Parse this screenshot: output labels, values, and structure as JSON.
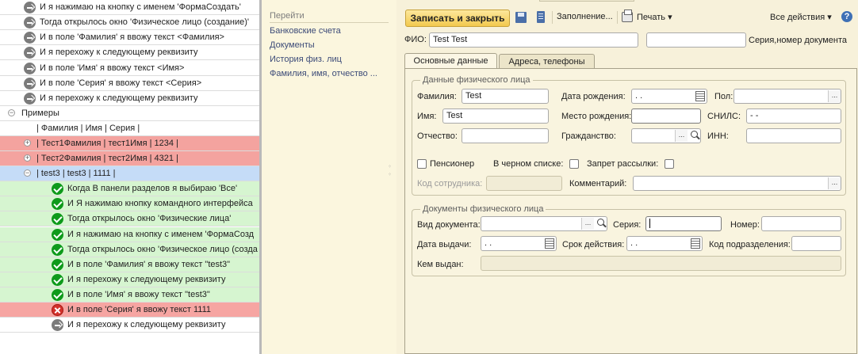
{
  "tree": {
    "rows": [
      {
        "text": "И я нажимаю на кнопку с именем 'ФормаСоздать'",
        "icon": "gray",
        "bg": "white"
      },
      {
        "text": "Тогда открылось окно 'Физическое лицо (создание)'",
        "icon": "gray",
        "bg": "white"
      },
      {
        "text": "И в поле 'Фамилия' я ввожу текст <Фамилия>",
        "icon": "gray",
        "bg": "white"
      },
      {
        "text": "И я перехожу к следующему реквизиту",
        "icon": "gray",
        "bg": "white"
      },
      {
        "text": "И в поле 'Имя' я ввожу текст <Имя>",
        "icon": "gray",
        "bg": "white"
      },
      {
        "text": "И в поле 'Серия' я ввожу текст <Серия>",
        "icon": "gray",
        "bg": "white"
      },
      {
        "text": "И я перехожу к следующему реквизиту",
        "icon": "gray",
        "bg": "white"
      },
      {
        "text": "Примеры",
        "toggle": "⊖",
        "bg": "white"
      },
      {
        "text": "| Фамилия     | Имя     | Серия |",
        "bg": "white"
      },
      {
        "text": "| Тест1Фамилия | тест1Имя | 1234  |",
        "toggle": "+",
        "bg": "red"
      },
      {
        "text": "| Тест2Фамилия | тест2Имя | 4321  |",
        "toggle": "+",
        "bg": "red"
      },
      {
        "text": "| test3      | test3   | 1111  |",
        "toggle": "⊖",
        "bg": "blue"
      },
      {
        "text": "Когда В панели разделов я выбираю 'Все'",
        "icon": "ok",
        "bg": "green"
      },
      {
        "text": "И Я нажимаю кнопку командного интерфейса",
        "icon": "ok",
        "bg": "green"
      },
      {
        "text": "Тогда открылось окно 'Физические лица'",
        "icon": "ok",
        "bg": "green"
      },
      {
        "text": "И я нажимаю на кнопку с именем 'ФормаСозд",
        "icon": "ok",
        "bg": "green"
      },
      {
        "text": "Тогда открылось окно 'Физическое лицо (созда",
        "icon": "ok",
        "bg": "green"
      },
      {
        "text": "И в поле 'Фамилия' я ввожу текст \"test3\"",
        "icon": "ok",
        "bg": "green"
      },
      {
        "text": "И я перехожу к следующему реквизиту",
        "icon": "ok",
        "bg": "green"
      },
      {
        "text": "И в поле 'Имя' я ввожу текст \"test3\"",
        "icon": "ok",
        "bg": "green"
      },
      {
        "text": "И в поле 'Серия' я ввожу текст 1111",
        "icon": "err",
        "bg": "lred"
      },
      {
        "text": "И я перехожу к следующему реквизиту",
        "icon": "gray",
        "bg": "white"
      }
    ]
  },
  "nav": {
    "title": "Перейти",
    "items": [
      "Банковские счета",
      "Документы",
      "История физ. лиц",
      "Фамилия, имя, отчество ..."
    ]
  },
  "toolbar": {
    "save_close": "Записать и закрыть",
    "fill": "Заполнение...",
    "print": "Печать ▾",
    "all_actions": "Все действия ▾",
    "help": "?"
  },
  "header": {
    "fio_label": "ФИО:",
    "fio_value": "Test Test",
    "series_label": "Серия,номер документа"
  },
  "tabs": {
    "main": "Основные данные",
    "address": "Адреса, телефоны"
  },
  "personal": {
    "title": "Данные физического лица",
    "surname_label": "Фамилия:",
    "surname_value": "Test",
    "name_label": "Имя:",
    "name_value": "Test",
    "patronymic_label": "Отчество:",
    "birthdate_label": "Дата рождения:",
    "birthdate_value": " .  .",
    "birthplace_label": "Место рождения:",
    "citizenship_label": "Гражданство:",
    "gender_label": "Пол:",
    "snils_label": "СНИЛС:",
    "snils_value": "   -   -",
    "inn_label": "ИНН:",
    "pensioner_label": "Пенсионер",
    "blacklist_label": "В черном списке:",
    "nomail_label": "Запрет рассылки:",
    "employee_code_label": "Код сотрудника:",
    "comment_label": "Комментарий:"
  },
  "docs": {
    "title": "Документы физического лица",
    "doctype_label": "Вид документа:",
    "series_label": "Серия:",
    "number_label": "Номер:",
    "issue_date_label": "Дата выдачи:",
    "issue_date_value": " .  .",
    "validity_label": "Срок действия:",
    "validity_value": " .  .",
    "dept_code_label": "Код подразделения:",
    "issued_by_label": "Кем выдан:"
  }
}
